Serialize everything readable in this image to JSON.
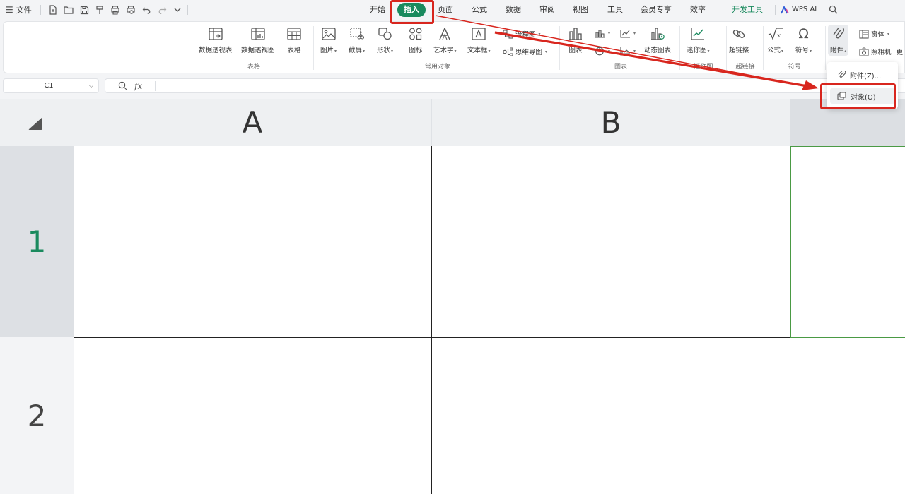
{
  "menubar": {
    "file_label": "文件",
    "tabs": [
      "开始",
      "插入",
      "页面",
      "公式",
      "数据",
      "审阅",
      "视图",
      "工具",
      "会员专享",
      "效率",
      "开发工具"
    ],
    "active_tab": "插入",
    "wps_ai_label": "WPS AI"
  },
  "ribbon": {
    "groups": {
      "table": {
        "label": "表格",
        "pivot_table": "数据透视表",
        "pivot_chart": "数据透视图",
        "table": "表格"
      },
      "common": {
        "label": "常用对象",
        "picture": "图片",
        "screenshot": "截屏",
        "shape": "形状",
        "icon": "图标",
        "wordart": "艺术字",
        "textbox": "文本框",
        "flowchart": "流程图",
        "mindmap": "思维导图"
      },
      "chart": {
        "label": "图表",
        "chart": "图表",
        "dynamic_chart": "动态图表"
      },
      "sparkline": {
        "label": "迷你图",
        "sparkline": "迷你图"
      },
      "hyperlink": {
        "label": "超链接",
        "hyperlink": "超链接"
      },
      "symbol": {
        "label": "符号",
        "formula": "公式",
        "symbol": "符号"
      },
      "more": {
        "attachment": "附件",
        "window": "窗体",
        "camera": "照相机",
        "more_cut": "更"
      }
    }
  },
  "formula_bar": {
    "cell_ref": "C1",
    "fx_label": "fx"
  },
  "grid": {
    "columns": [
      "A",
      "B"
    ],
    "rows": [
      "1",
      "2"
    ]
  },
  "popup": {
    "items": [
      "附件(Z)...",
      "对象(O)"
    ]
  },
  "colors": {
    "accent": "#1a8a5e",
    "annotation": "#d8261e"
  }
}
